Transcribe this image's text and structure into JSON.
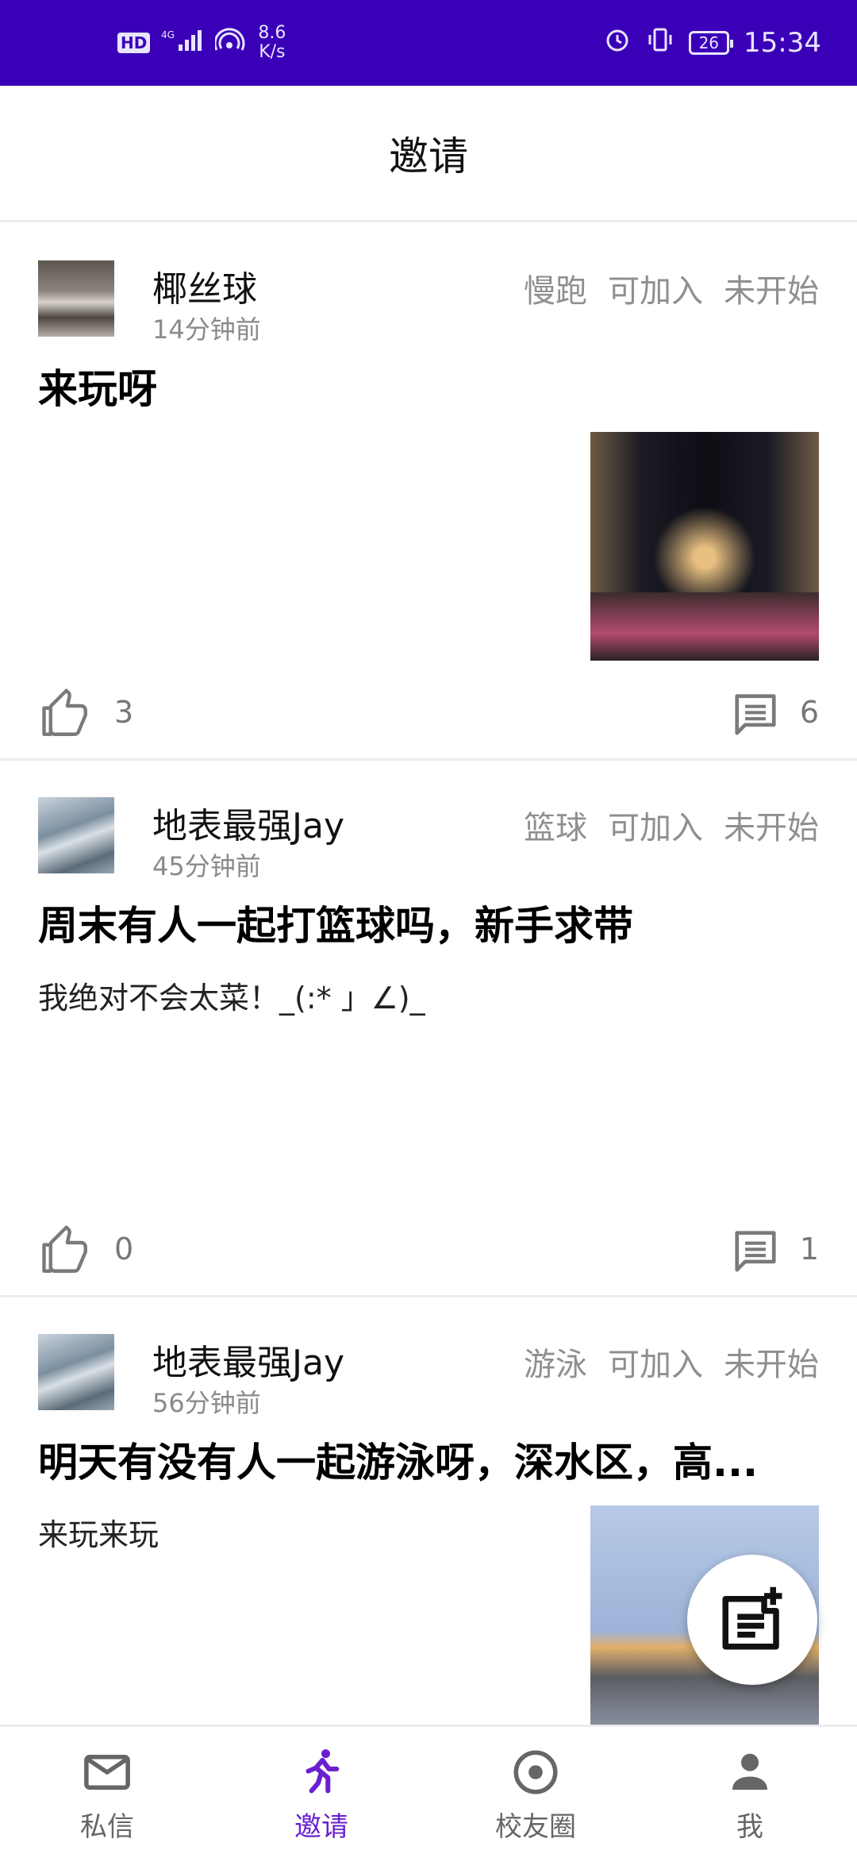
{
  "status_bar": {
    "hd": "HD",
    "network": "4G",
    "speed_value": "8.6",
    "speed_unit": "K/s",
    "battery": "26",
    "time": "15:34"
  },
  "header": {
    "title": "邀请"
  },
  "posts": [
    {
      "username": "椰丝球",
      "time": "14分钟前",
      "tags": [
        "慢跑",
        "可加入",
        "未开始"
      ],
      "title": "来玩呀",
      "body": "",
      "likes": "3",
      "comments": "6"
    },
    {
      "username": "地表最强Jay",
      "time": "45分钟前",
      "tags": [
        "篮球",
        "可加入",
        "未开始"
      ],
      "title": "周末有人一起打篮球吗，新手求带",
      "body": "我绝对不会太菜！_(:* 」∠)_",
      "likes": "0",
      "comments": "1"
    },
    {
      "username": "地表最强Jay",
      "time": "56分钟前",
      "tags": [
        "游泳",
        "可加入",
        "未开始"
      ],
      "title": "明天有没有人一起游泳呀，深水区，高...",
      "body": "来玩来玩"
    }
  ],
  "nav": {
    "items": [
      {
        "label": "私信",
        "icon": "mail-icon"
      },
      {
        "label": "邀请",
        "icon": "runner-icon"
      },
      {
        "label": "校友圈",
        "icon": "target-icon"
      },
      {
        "label": "我",
        "icon": "person-icon"
      }
    ]
  },
  "colors": {
    "status_bar": "#3a00b8",
    "accent": "#6a1fd0",
    "divider": "#ececec"
  }
}
